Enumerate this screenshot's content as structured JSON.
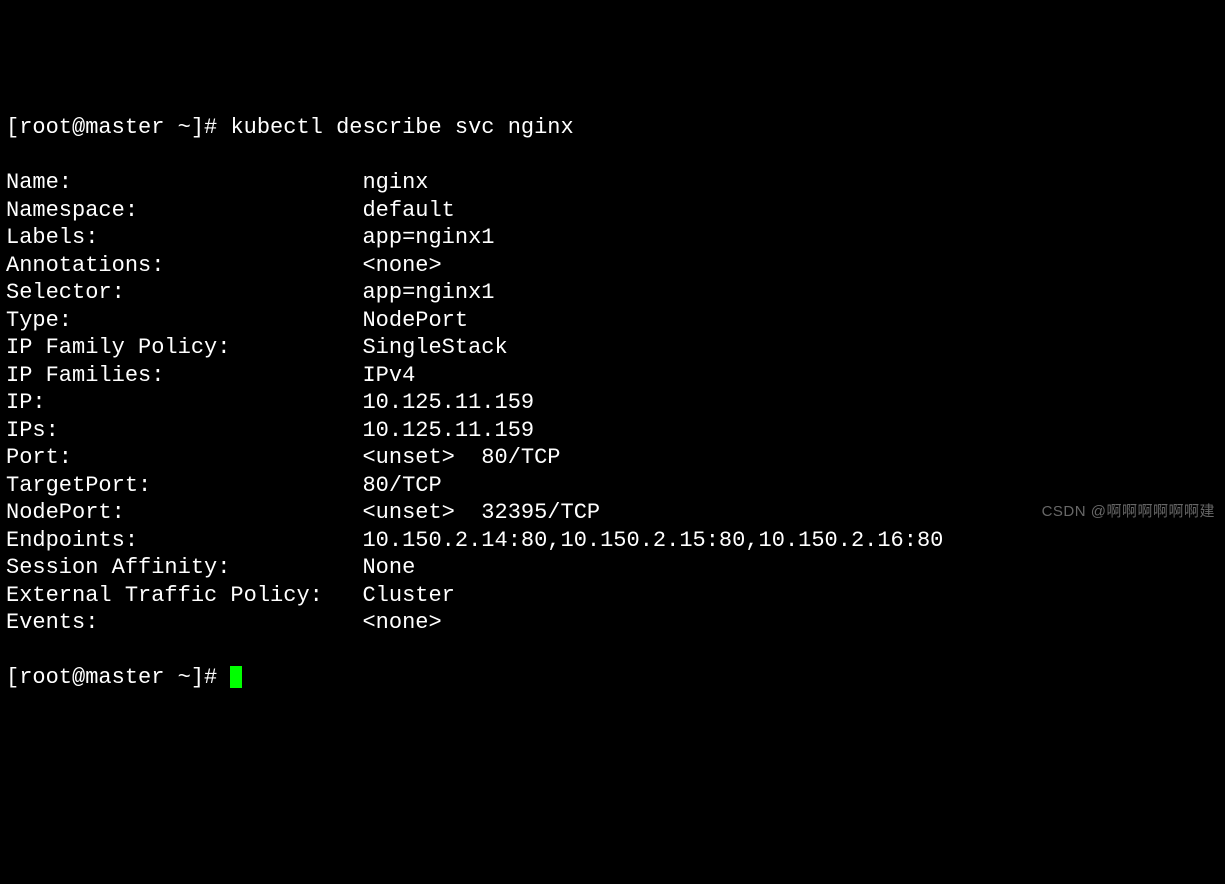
{
  "prompt": {
    "user": "root",
    "host": "master",
    "path": "~",
    "symbol": "#"
  },
  "command": "kubectl describe svc nginx",
  "rows": [
    {
      "key": "Name:",
      "value": "nginx"
    },
    {
      "key": "Namespace:",
      "value": "default"
    },
    {
      "key": "Labels:",
      "value": "app=nginx1"
    },
    {
      "key": "Annotations:",
      "value": "<none>"
    },
    {
      "key": "Selector:",
      "value": "app=nginx1"
    },
    {
      "key": "Type:",
      "value": "NodePort"
    },
    {
      "key": "IP Family Policy:",
      "value": "SingleStack"
    },
    {
      "key": "IP Families:",
      "value": "IPv4"
    },
    {
      "key": "IP:",
      "value": "10.125.11.159"
    },
    {
      "key": "IPs:",
      "value": "10.125.11.159"
    },
    {
      "key": "Port:",
      "value": "<unset>  80/TCP"
    },
    {
      "key": "TargetPort:",
      "value": "80/TCP"
    },
    {
      "key": "NodePort:",
      "value": "<unset>  32395/TCP"
    },
    {
      "key": "Endpoints:",
      "value": "10.150.2.14:80,10.150.2.15:80,10.150.2.16:80"
    },
    {
      "key": "Session Affinity:",
      "value": "None"
    },
    {
      "key": "External Traffic Policy:",
      "value": "Cluster"
    },
    {
      "key": "Events:",
      "value": "<none>"
    }
  ],
  "key_column_width": 27,
  "watermark": "CSDN @啊啊啊啊啊啊建"
}
